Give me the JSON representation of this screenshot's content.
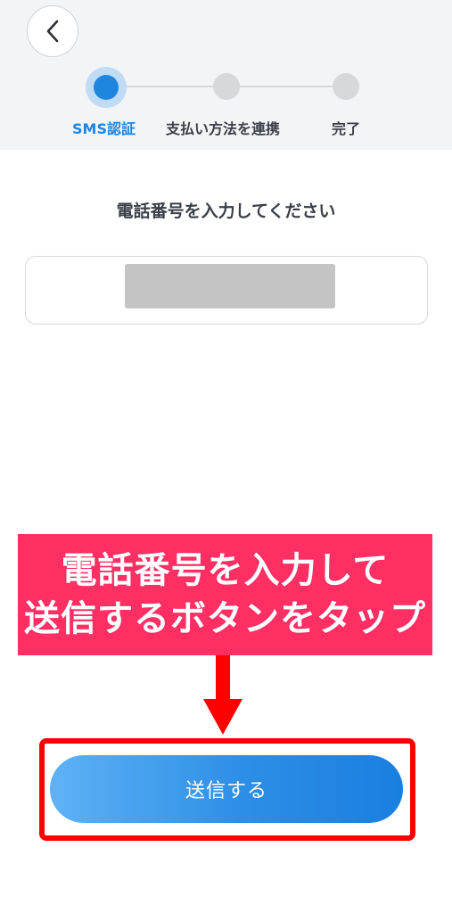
{
  "header": {
    "back_button": {
      "icon": "chevron-left-icon"
    }
  },
  "stepper": {
    "steps": [
      {
        "label": "SMS認証",
        "state": "active"
      },
      {
        "label": "支払い方法を連携",
        "state": "inactive"
      },
      {
        "label": "完了",
        "state": "inactive"
      }
    ],
    "active_color": "#1f86e0",
    "inactive_color": "#d6d8dc"
  },
  "form": {
    "prompt": "電話番号を入力してください",
    "phone_value_redacted": true
  },
  "annotation": {
    "callout_lines": [
      "電話番号を入力して",
      "送信するボタンをタップ"
    ],
    "callout_color": "#ff2e63",
    "arrow_color": "#ff0000",
    "highlight_color": "#ff0000"
  },
  "actions": {
    "send_label": "送信する",
    "button_gradient": [
      "#5fb2f5",
      "#1a7fdf"
    ]
  }
}
